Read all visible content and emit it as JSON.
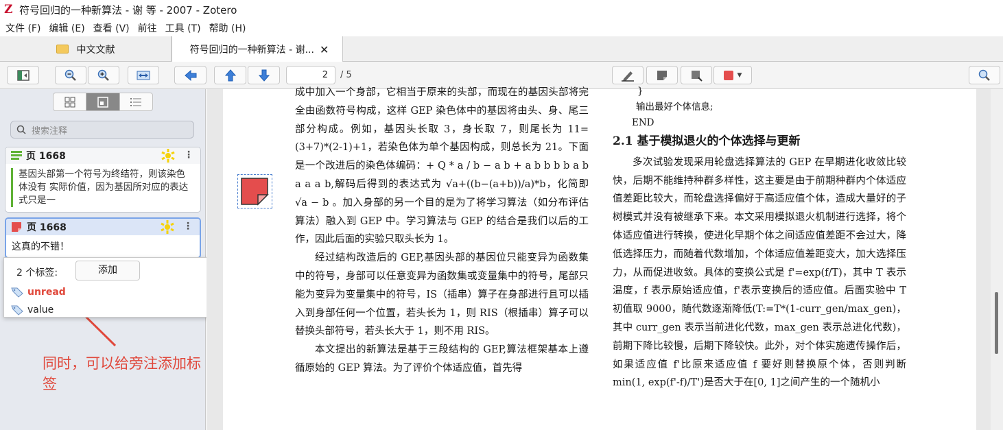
{
  "window": {
    "title": "符号回归的一种新算法 - 谢 等 - 2007 - Zotero",
    "app_icon_letter": "Z"
  },
  "menu": {
    "file": "文件 (F)",
    "edit": "编辑 (E)",
    "view": "查看 (V)",
    "go": "前往",
    "tools": "工具 (T)",
    "help": "帮助 (H)"
  },
  "tabs": {
    "library": "中文文献",
    "reader": "符号回归的一种新算法 - 谢...",
    "close": "✕"
  },
  "toolbar": {
    "current_page": "2",
    "page_total": "/ 5",
    "highlight_color": "#e44d4d"
  },
  "sidebar": {
    "search_placeholder": "搜索注释",
    "annotations": [
      {
        "page": "页 1668",
        "text": "基因头部第一个符号为终结符，则该染色体没有 实际价值，因为基因所对应的表达式只是一",
        "color": "#5fb236"
      },
      {
        "page": "页 1668",
        "text": "这真的不错！",
        "color": "#e44d4d"
      }
    ],
    "tags_popup": {
      "count_label": "2 个标签:",
      "add_label": "添加",
      "tags": [
        "unread",
        "value"
      ]
    },
    "callout": "同时，可以给旁注添加标签"
  },
  "document": {
    "left_column": [
      "成中加入一个身部，它相当于原来的头部，而现在的基因头部将完全由函数符号构成，这样 GEP 染色体中的基因将由头、身、尾三部分构成。例如，基因头长取 3，身长取 7，则尾长为 11=(3+7)*(2-1)+1，若染色体为单个基因构成，则总长为 21。下面是一个改进后的染色体编码：+ Q * a / b − a b + a b b b b a b a a a b,解码后得到的表达式为 √a+((b−(a+b))/a)*b，化简即 √a − b 。加入身部的另一个目的是为了将学习算法（如分布评估算法）融入到 GEP 中。学习算法与 GEP 的结合是我们以后的工作，因此后面的实验只取头长为 1。",
      "经过结构改造后的 GEP,基因头部的基因位只能变异为函数集中的符号，身部可以任意变异为函数集或变量集中的符号，尾部只能为变异为变量集中的符号，IS（插串）算子在身部进行且可以插入到身部任何一个位置，若头长为 1，则 RIS（根插串）算子可以替换头部符号，若头长大于 1，则不用 RIS。",
      "本文提出的新算法是基于三段结构的 GEP,算法框架基本上遵循原始的 GEP 算法。为了评价个体适应值，首先得"
    ],
    "right_column": {
      "code": [
        "}",
        "输出最好个体信息;",
        "END"
      ],
      "heading": "2.1  基于模拟退火的个体选择与更新",
      "paragraph": "多次试验发现采用轮盘选择算法的 GEP 在早期进化收敛比较快，后期不能维持种群多样性，这主要是由于前期种群内个体适应值差距比较大，而轮盘选择偏好于高适应值个体，造成大量好的子树模式并没有被继承下来。本文采用模拟退火机制进行选择，将个体适应值进行转换，使进化早期个体之间适应值差距不会过大，降低选择压力，而随着代数增加，个体适应值差距变大，加大选择压力，从而促进收敛。具体的变换公式是 f'=exp(f/T)，其中 T 表示温度，f 表示原始适应值，f'表示变换后的适应值。后面实验中 T 初值取 9000，随代数逐渐降低(T:=T*(1-curr_gen/max_gen)，其中 curr_gen 表示当前进化代数，max_gen 表示总进化代数)，前期下降比较慢，后期下降较快。此外，对个体实施遗传操作后，如果适应值 f'比原来适应值 f 要好则替换原个体，否则判断 min(1, exp(f'-f)/T')是否大于在[0, 1]之间产生的一个随机小"
    }
  }
}
